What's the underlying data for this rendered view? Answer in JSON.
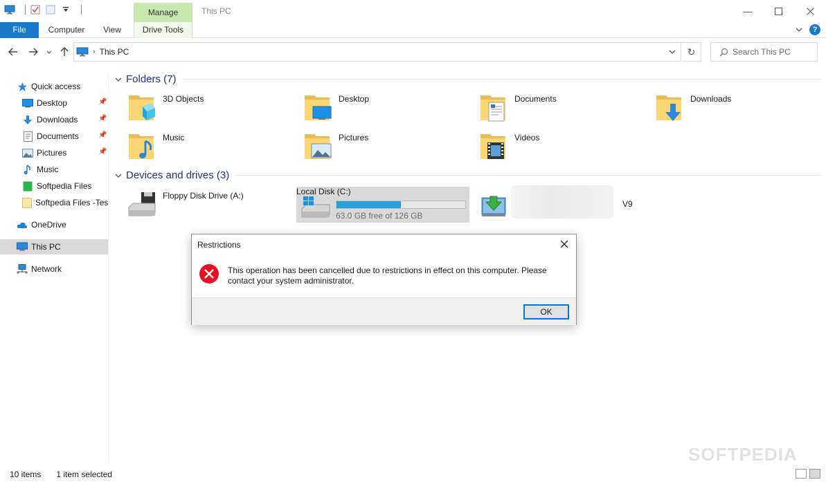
{
  "window": {
    "title": "This PC",
    "contextual_tab": "Manage"
  },
  "ribbon": {
    "tabs": [
      "File",
      "Computer",
      "View",
      "Drive Tools"
    ]
  },
  "address": {
    "crumb": "This PC",
    "search_placeholder": "Search This PC"
  },
  "sidebar": {
    "items": [
      {
        "label": "Quick access",
        "icon": "star-icon"
      },
      {
        "label": "Desktop",
        "icon": "desktop-icon",
        "pinned": true
      },
      {
        "label": "Downloads",
        "icon": "download-icon",
        "pinned": true
      },
      {
        "label": "Documents",
        "icon": "document-icon",
        "pinned": true
      },
      {
        "label": "Pictures",
        "icon": "picture-icon",
        "pinned": true
      },
      {
        "label": "Music",
        "icon": "music-icon"
      },
      {
        "label": "Softpedia Files",
        "icon": "folder-green-icon"
      },
      {
        "label": "Softpedia Files -Test",
        "icon": "folder-icon"
      },
      {
        "label": "OneDrive",
        "icon": "cloud-icon"
      },
      {
        "label": "This PC",
        "icon": "computer-icon",
        "selected": true
      },
      {
        "label": "Network",
        "icon": "network-icon"
      }
    ]
  },
  "content": {
    "folders_header": "Folders (7)",
    "folders": [
      "3D Objects",
      "Desktop",
      "Documents",
      "Downloads",
      "Music",
      "Pictures",
      "Videos"
    ],
    "devices_header": "Devices and drives (3)",
    "drives": [
      {
        "label": "Floppy Disk Drive (A:)"
      },
      {
        "label": "Local Disk (C:)",
        "free": "63.0 GB free of 126 GB",
        "used_fraction": 0.5
      },
      {
        "label_fragment": "V9"
      }
    ]
  },
  "status": {
    "items": "10 items",
    "selected": "1 item selected"
  },
  "dialog": {
    "title": "Restrictions",
    "message": "This operation has been cancelled due to restrictions in effect on this computer. Please contact your system administrator.",
    "ok_label": "OK"
  },
  "watermark": "SOFTPEDIA",
  "colors": {
    "accent": "#1979ca",
    "manage_tab": "#c8e8b0",
    "drive_bar": "#26a0da",
    "error": "#e81123",
    "header_blue": "#1e3287"
  }
}
